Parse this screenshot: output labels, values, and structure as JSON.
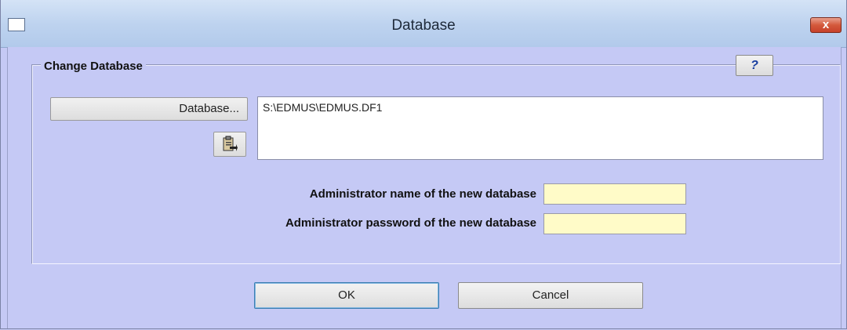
{
  "window": {
    "title": "Database",
    "close_label": "x",
    "icon": "window-icon"
  },
  "group": {
    "label": "Change Database",
    "help_label": "?",
    "database_button_label": "Database...",
    "paste_icon": "clipboard-paste-icon",
    "database_path": "S:\\EDMUS\\EDMUS.DF1"
  },
  "fields": {
    "admin_name_label": "Administrator name of the new database",
    "admin_name_value": "",
    "admin_password_label": "Administrator password of the new database",
    "admin_password_value": ""
  },
  "buttons": {
    "ok_label": "OK",
    "cancel_label": "Cancel"
  },
  "colors": {
    "background": "#c5c9f5",
    "field_background": "#fffbc8",
    "close_button": "#c7412a",
    "help_text": "#1a3fa0"
  }
}
